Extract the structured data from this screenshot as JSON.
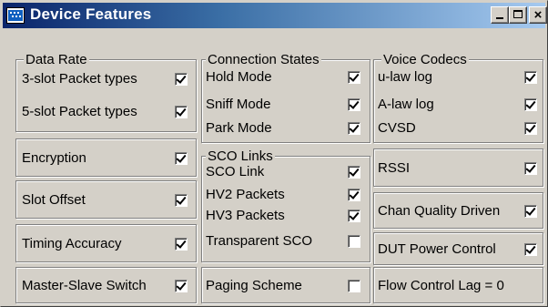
{
  "window": {
    "title": "Device Features"
  },
  "data_rate": {
    "legend": "Data Rate",
    "items": [
      {
        "label": "3-slot Packet types",
        "checked": true
      },
      {
        "label": "5-slot Packet types",
        "checked": true
      }
    ]
  },
  "connection_states": {
    "legend": "Connection States",
    "items": [
      {
        "label": "Hold Mode",
        "checked": true
      },
      {
        "label": "Sniff Mode",
        "checked": true
      },
      {
        "label": "Park Mode",
        "checked": true
      }
    ]
  },
  "voice_codecs": {
    "legend": "Voice Codecs",
    "items": [
      {
        "label": "u-law log",
        "checked": true
      },
      {
        "label": "A-law log",
        "checked": true
      },
      {
        "label": "CVSD",
        "checked": true
      }
    ]
  },
  "sco_links": {
    "legend": "SCO Links",
    "items": [
      {
        "label": "SCO Link",
        "checked": true
      },
      {
        "label": "HV2 Packets",
        "checked": true
      },
      {
        "label": "HV3 Packets",
        "checked": true
      },
      {
        "label": "Transparent SCO",
        "checked": false
      }
    ]
  },
  "single": {
    "encryption": {
      "label": "Encryption",
      "checked": true
    },
    "slot_offset": {
      "label": "Slot Offset",
      "checked": true
    },
    "timing_accuracy": {
      "label": "Timing Accuracy",
      "checked": true
    },
    "master_slave_switch": {
      "label": "Master-Slave Switch",
      "checked": true
    },
    "paging_scheme": {
      "label": "Paging Scheme",
      "checked": false
    },
    "rssi": {
      "label": "RSSI",
      "checked": true
    },
    "chan_quality_driven": {
      "label": "Chan Quality Driven",
      "checked": true
    },
    "dut_power_control": {
      "label": "DUT Power Control",
      "checked": true
    },
    "flow_control_lag": {
      "label": "Flow Control Lag = 0"
    }
  },
  "colors": {
    "face": "#d4d0c8",
    "title_start": "#0a246a",
    "title_end": "#a6caf0"
  }
}
